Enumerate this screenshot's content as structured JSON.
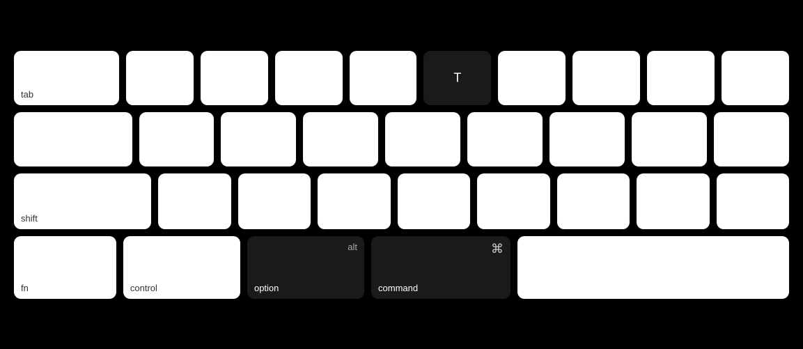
{
  "keyboard": {
    "rows": [
      {
        "id": "row1",
        "keys": [
          {
            "id": "tab",
            "label": "tab",
            "wide": true,
            "dark": false
          },
          {
            "id": "q",
            "label": "",
            "dark": false
          },
          {
            "id": "w",
            "label": "",
            "dark": false
          },
          {
            "id": "e",
            "label": "",
            "dark": false
          },
          {
            "id": "r",
            "label": "",
            "dark": false
          },
          {
            "id": "t",
            "label": "T",
            "dark": true
          },
          {
            "id": "y",
            "label": "",
            "dark": false
          },
          {
            "id": "u",
            "label": "",
            "dark": false
          },
          {
            "id": "i",
            "label": "",
            "dark": false
          },
          {
            "id": "o",
            "label": "",
            "dark": false
          }
        ]
      },
      {
        "id": "row2",
        "keys": [
          {
            "id": "caps",
            "label": "",
            "wide": true,
            "dark": false
          },
          {
            "id": "a",
            "label": "",
            "dark": false
          },
          {
            "id": "s",
            "label": "",
            "dark": false
          },
          {
            "id": "d",
            "label": "",
            "dark": false
          },
          {
            "id": "f",
            "label": "",
            "dark": false
          },
          {
            "id": "g",
            "label": "",
            "dark": false
          },
          {
            "id": "h",
            "label": "",
            "dark": false
          },
          {
            "id": "j",
            "label": "",
            "dark": false
          },
          {
            "id": "k",
            "label": "",
            "dark": false
          }
        ]
      },
      {
        "id": "row3",
        "keys": [
          {
            "id": "shift",
            "label": "shift",
            "shift": true,
            "dark": false
          },
          {
            "id": "z",
            "label": "",
            "dark": false
          },
          {
            "id": "x",
            "label": "",
            "dark": false
          },
          {
            "id": "c",
            "label": "",
            "dark": false
          },
          {
            "id": "v",
            "label": "",
            "dark": false
          },
          {
            "id": "b",
            "label": "",
            "dark": false
          },
          {
            "id": "n",
            "label": "",
            "dark": false
          },
          {
            "id": "m",
            "label": "",
            "dark": false
          },
          {
            "id": "comma",
            "label": "",
            "dark": false
          }
        ]
      },
      {
        "id": "row4",
        "keys": [
          {
            "id": "fn",
            "label": "fn",
            "fn": true,
            "dark": false
          },
          {
            "id": "control",
            "label": "control",
            "control": true,
            "dark": false
          },
          {
            "id": "option",
            "label": "option",
            "topLabel": "alt",
            "dark": true
          },
          {
            "id": "command",
            "label": "command",
            "topLabel": "⌘",
            "dark": true,
            "cmd": true
          },
          {
            "id": "space",
            "label": "",
            "space": true,
            "dark": false
          }
        ]
      }
    ]
  }
}
